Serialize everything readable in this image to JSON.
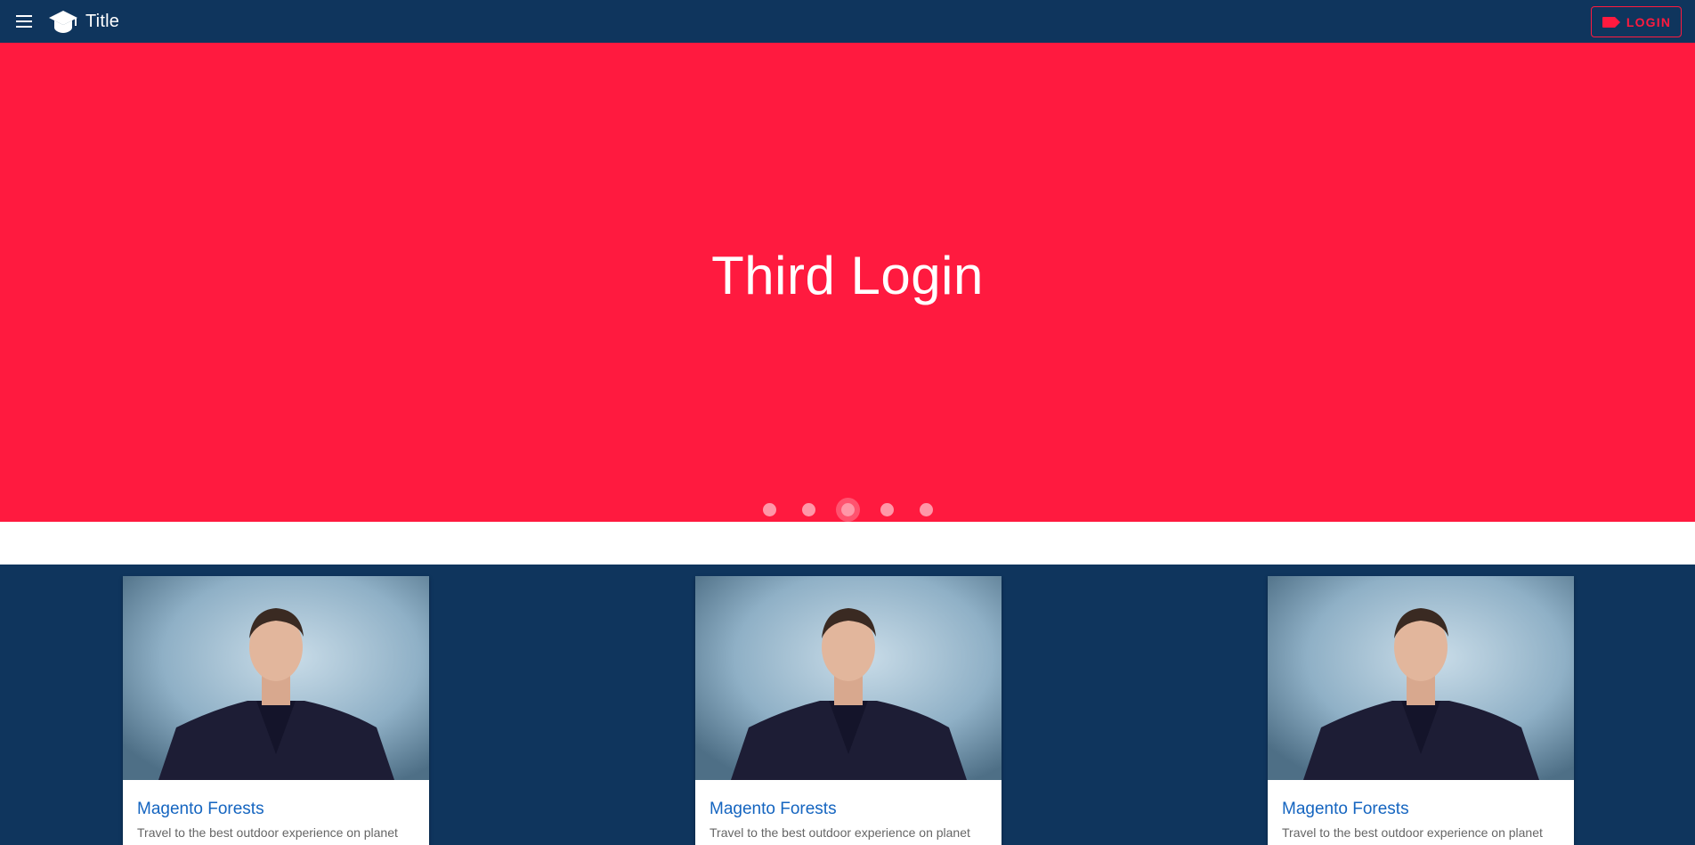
{
  "app_bar": {
    "title": "Title",
    "menu_icon": "hamburger-menu-icon",
    "logo_icon": "graduation-cap-icon",
    "login_label": "LOGIN",
    "login_icon": "label-tag-icon"
  },
  "hero": {
    "title": "Third Login",
    "slide_count": 5,
    "active_slide_index": 2
  },
  "cards": [
    {
      "title": "Magento Forests",
      "subtitle": "Travel to the best outdoor experience on planet"
    },
    {
      "title": "Magento Forests",
      "subtitle": "Travel to the best outdoor experience on planet"
    },
    {
      "title": "Magento Forests",
      "subtitle": "Travel to the best outdoor experience on planet"
    }
  ],
  "colors": {
    "primary_dark": "#0f355d",
    "accent": "#ff1a3f",
    "card_title": "#1565c0"
  }
}
